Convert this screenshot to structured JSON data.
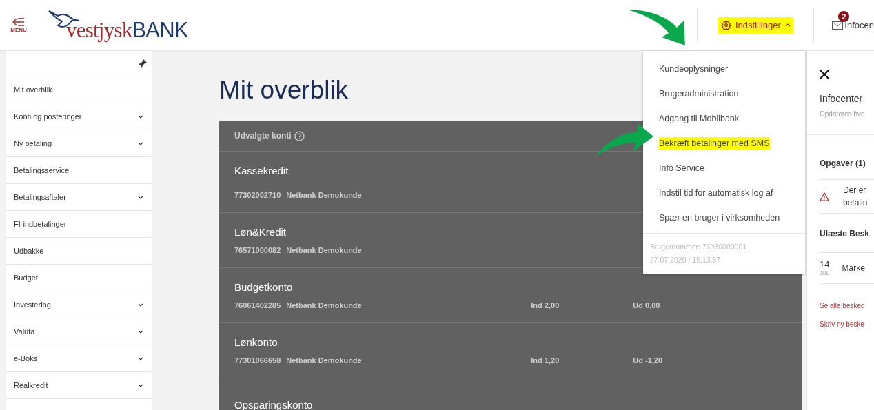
{
  "header": {
    "menu_label": "MENU",
    "logo": {
      "part_1": "vestjysk",
      "part_2": "BANK"
    },
    "settings": {
      "label": "Indstillinger",
      "expanded": true,
      "highlighted": true
    },
    "infocenter": {
      "label": "Infocen",
      "badge": "2"
    }
  },
  "sidebar": {
    "pinned": true,
    "items": [
      {
        "label": "Mit overblik",
        "expandable": false
      },
      {
        "label": "Konti og posteringer",
        "expandable": true
      },
      {
        "label": "Ny betaling",
        "expandable": true
      },
      {
        "label": "Betalingsservice",
        "expandable": false
      },
      {
        "label": "Betalingsaftaler",
        "expandable": true
      },
      {
        "label": "FI-indbetalinger",
        "expandable": false
      },
      {
        "label": "Udbakke",
        "expandable": false
      },
      {
        "label": "Budget",
        "expandable": false
      },
      {
        "label": "Investering",
        "expandable": true
      },
      {
        "label": "Valuta",
        "expandable": true
      },
      {
        "label": "e-Boks",
        "expandable": true
      },
      {
        "label": "Realkredit",
        "expandable": true
      }
    ]
  },
  "main": {
    "title": "Mit overblik",
    "accounts_card": {
      "title": "Udvalgte konti",
      "accounts": [
        {
          "name": "Kassekredit",
          "number": "77302002710",
          "owner": "Netbank Demokunde"
        },
        {
          "name": "Løn&Kredit",
          "number": "76571000082",
          "owner": "Netbank Demokunde"
        },
        {
          "name": "Budgetkonto",
          "number": "76061402285",
          "owner": "Netbank Demokunde",
          "in_label": "Ind",
          "in": "2,00",
          "out_label": "Ud",
          "out": "0,00"
        },
        {
          "name": "Lønkonto",
          "number": "77301066658",
          "owner": "Netbank Demokunde",
          "in_label": "Ind",
          "in": "1,20",
          "out_label": "Ud",
          "out": "-1,20"
        },
        {
          "name": "Opsparingskonto"
        }
      ]
    }
  },
  "settings_menu": {
    "items": [
      {
        "label": "Kundeoplysninger",
        "highlighted": false
      },
      {
        "label": "Brugeradministration",
        "highlighted": false
      },
      {
        "label": "Adgang til Mobilbank",
        "highlighted": false
      },
      {
        "label": "Bekræft betalinger med SMS",
        "highlighted": true
      },
      {
        "label": "Info Service",
        "highlighted": false
      },
      {
        "label": "Indstil tid for automatisk log af",
        "highlighted": false
      },
      {
        "label": "Spær en bruger i virksomheden",
        "highlighted": false
      }
    ],
    "user_number": "Brugernummer: 76030000001",
    "timestamp": "27.07.2020 / 15.13.57"
  },
  "info_panel": {
    "title": "Infocenter",
    "subtitle": "Opdateres hve",
    "tasks_heading": "Opgaver (1)",
    "tasks": [
      {
        "line_1": "Der er",
        "line_2": "betalin"
      }
    ],
    "messages_heading": "Ulæste Besk",
    "messages": [
      {
        "day": "14",
        "month": "JUL",
        "subject": "Marke"
      }
    ],
    "links": [
      "Se alle besked",
      "Skriv ny beske"
    ]
  }
}
